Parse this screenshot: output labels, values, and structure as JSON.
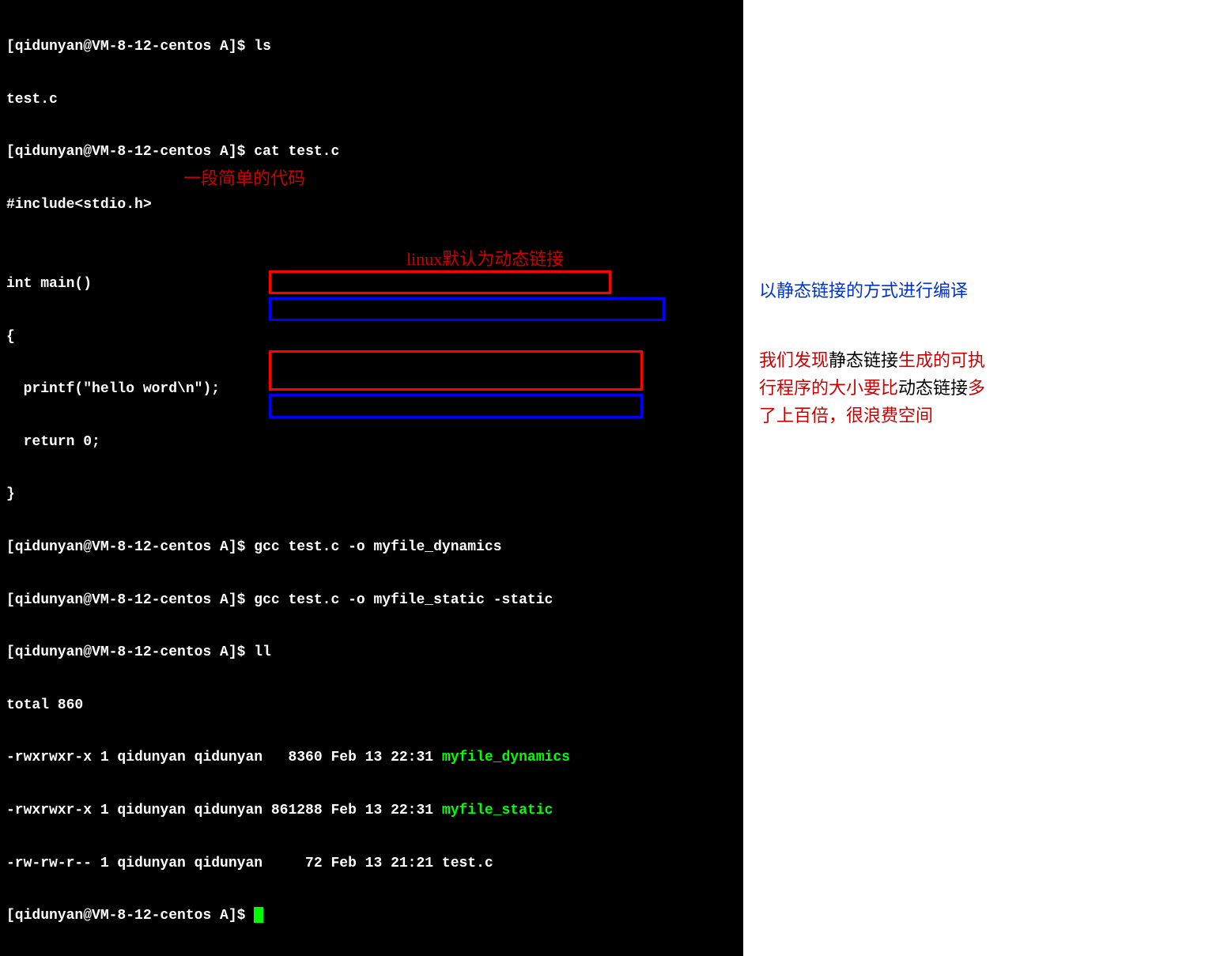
{
  "prompt": "[qidunyan@VM-8-12-centos A]$ ",
  "commands": {
    "ls": "ls",
    "cat": "cat test.c",
    "gcc_dyn": "gcc test.c -o myfile_dynamics",
    "gcc_static": "gcc test.c -o myfile_static -static",
    "ll": "ll"
  },
  "ls_output": "test.c",
  "cat_output": {
    "l1": "#include<stdio.h>",
    "l2": "",
    "l3": "int main()",
    "l4": "{",
    "l5": "  printf(\"hello word\\n\");",
    "l6": "  return 0;",
    "l7": "}"
  },
  "ll_output": {
    "total": "total 860",
    "row1_a": "-rwxrwxr-x 1 qidunyan qidunyan   8360 Feb 13 22:31 ",
    "row1_b": "myfile_dynamics",
    "row2_a": "-rwxrwxr-x 1 qidunyan qidunyan 861288 Feb 13 22:31 ",
    "row2_b": "myfile_static",
    "row3": "-rw-rw-r-- 1 qidunyan qidunyan     72 Feb 13 21:21 test.c"
  },
  "last_prompt": "[qidunyan@VM-8-12-centos A]$ ",
  "annotations": {
    "simple_code": "一段简单的代码",
    "default_dynamic": "linux默认为动态链接",
    "static_compile": "以静态链接的方式进行编译",
    "note_p1": "我们发现",
    "note_p2": "静态链接",
    "note_p3": "生成的可执行程序的大小要比",
    "note_p4": "动态链接",
    "note_p5": "多了上百倍，很浪费空间"
  }
}
